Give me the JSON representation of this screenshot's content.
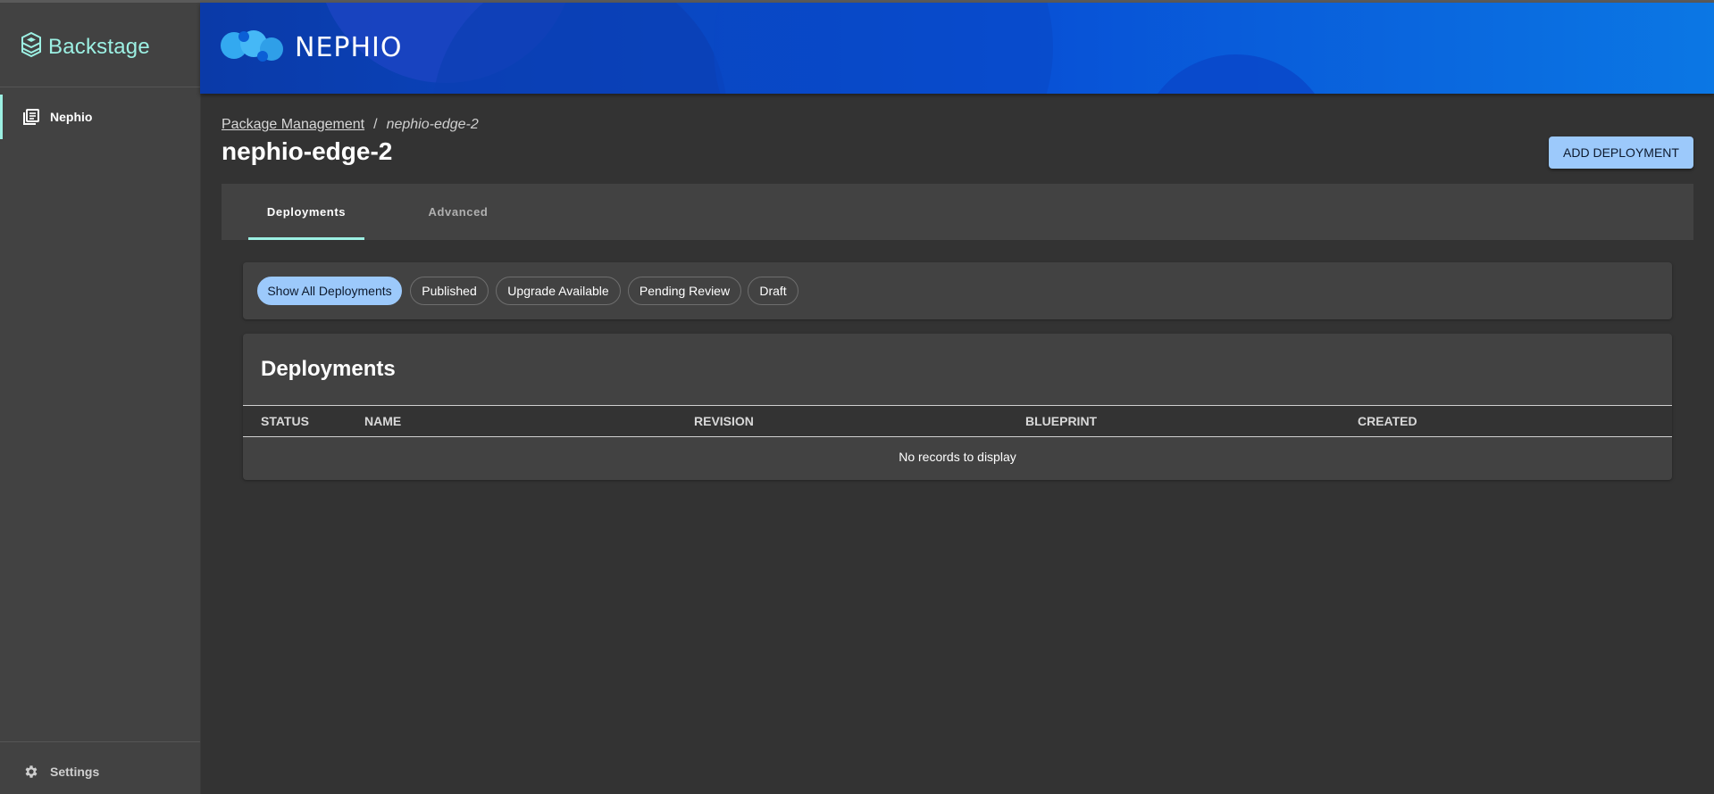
{
  "sidebar": {
    "brand": "Backstage",
    "items": [
      {
        "label": "Nephio",
        "icon": "library-icon",
        "active": true
      }
    ],
    "settings_label": "Settings"
  },
  "banner": {
    "logo_text": "NEPHIO"
  },
  "breadcrumb": {
    "parent": "Package Management",
    "separator": "/",
    "current": "nephio-edge-2"
  },
  "page": {
    "title": "nephio-edge-2",
    "add_button": "ADD DEPLOYMENT"
  },
  "tabs": [
    {
      "label": "Deployments",
      "active": true
    },
    {
      "label": "Advanced",
      "active": false
    }
  ],
  "filters": [
    {
      "label": "Show All Deployments",
      "selected": true
    },
    {
      "label": "Published",
      "selected": false
    },
    {
      "label": "Upgrade Available",
      "selected": false
    },
    {
      "label": "Pending Review",
      "selected": false
    },
    {
      "label": "Draft",
      "selected": false
    }
  ],
  "table": {
    "title": "Deployments",
    "columns": [
      "STATUS",
      "NAME",
      "REVISION",
      "BLUEPRINT",
      "CREATED"
    ],
    "rows": [],
    "empty_message": "No records to display"
  },
  "colors": {
    "accent": "#9cf0e3",
    "primary_button": "#9cc9fb",
    "background": "#333333",
    "panel": "#424242"
  }
}
